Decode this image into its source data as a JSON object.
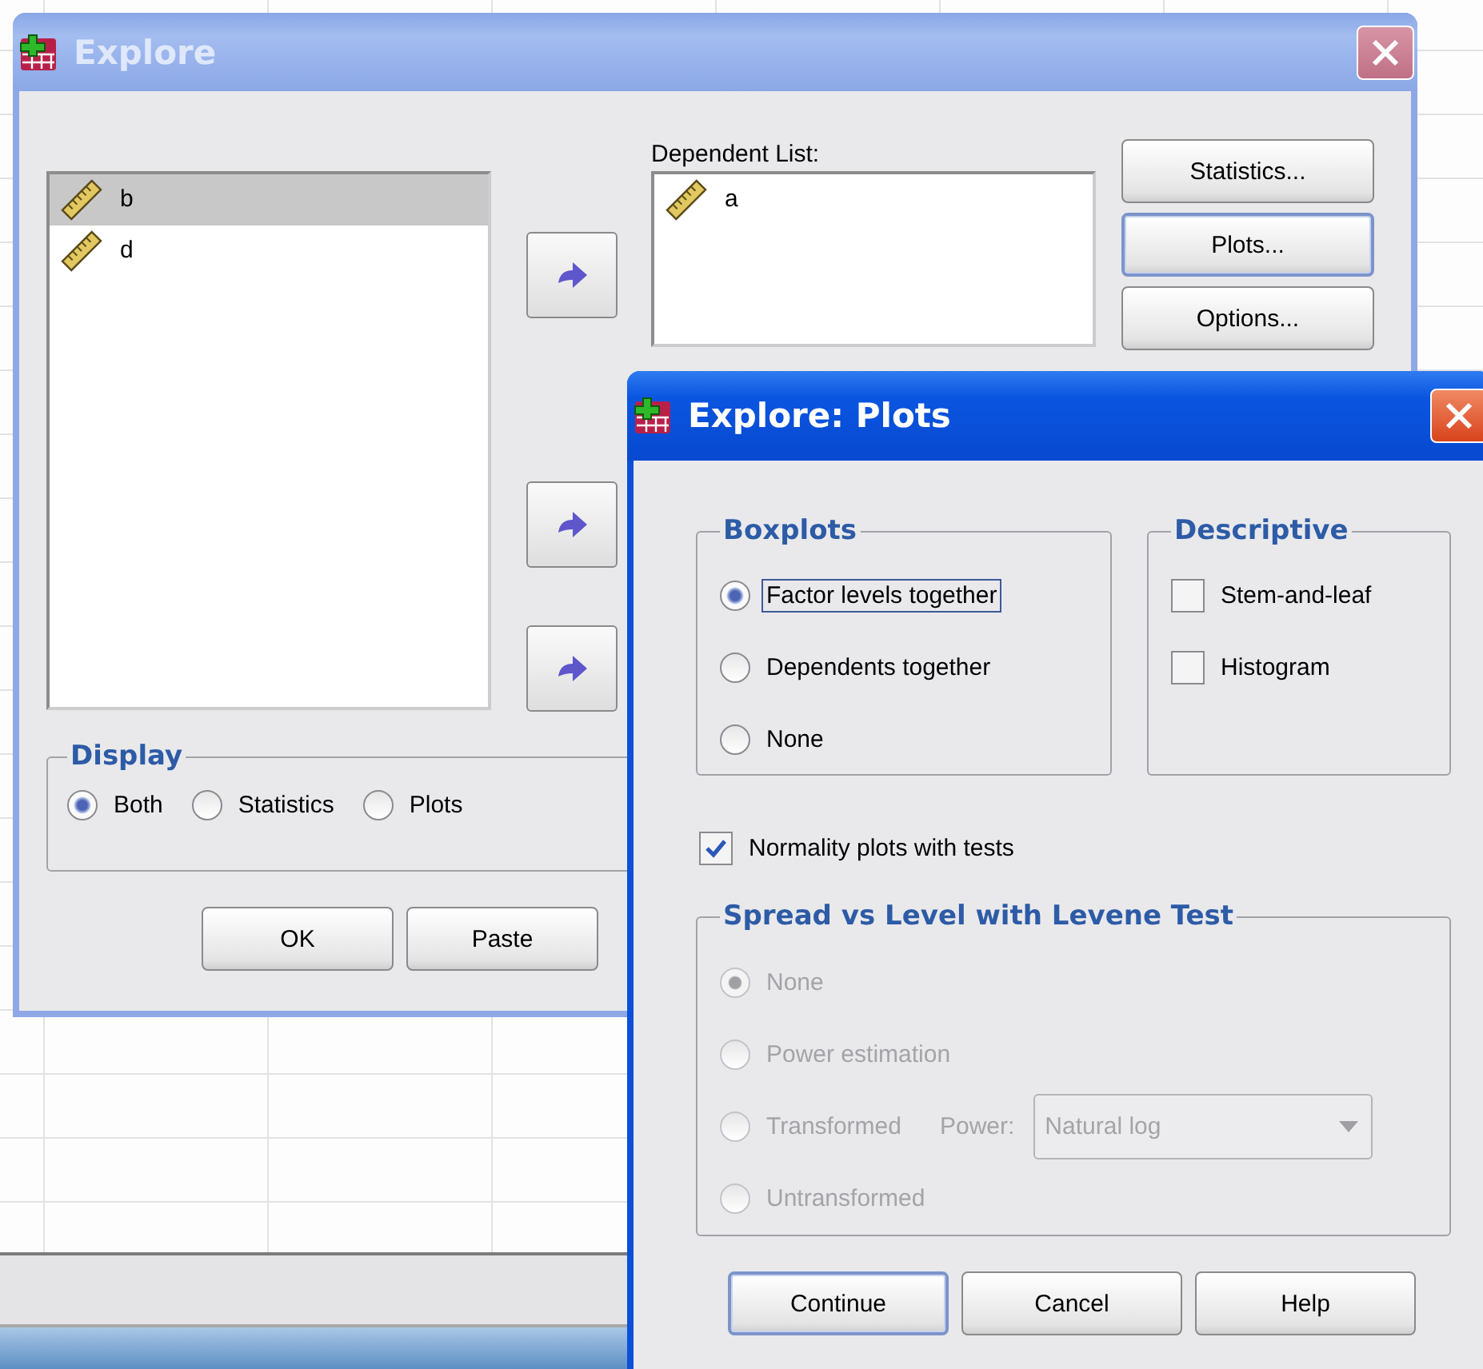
{
  "explore": {
    "title": "Explore",
    "variables": [
      {
        "name": "b",
        "selected": true
      },
      {
        "name": "d",
        "selected": false
      }
    ],
    "dependent_list": {
      "label": "Dependent List:",
      "items": [
        {
          "name": "a"
        }
      ]
    },
    "side_buttons": [
      {
        "label": "Statistics...",
        "focused": false
      },
      {
        "label": "Plots...",
        "focused": true
      },
      {
        "label": "Options...",
        "focused": false
      }
    ],
    "display": {
      "title": "Display",
      "options": [
        {
          "label": "Both",
          "selected": true
        },
        {
          "label": "Statistics",
          "selected": false
        },
        {
          "label": "Plots",
          "selected": false
        }
      ]
    },
    "buttons": [
      {
        "label": "OK"
      },
      {
        "label": "Paste"
      }
    ]
  },
  "plots": {
    "title": "Explore: Plots",
    "boxplots": {
      "title": "Boxplots",
      "options": [
        {
          "label": "Factor levels together",
          "selected": true,
          "focused": true
        },
        {
          "label": "Dependents together",
          "selected": false,
          "focused": false
        },
        {
          "label": "None",
          "selected": false,
          "focused": false
        }
      ]
    },
    "descriptive": {
      "title": "Descriptive",
      "options": [
        {
          "label": "Stem-and-leaf",
          "checked": false
        },
        {
          "label": "Histogram",
          "checked": false
        }
      ]
    },
    "normality": {
      "label": "Normality plots with tests",
      "checked": true
    },
    "spread": {
      "title": "Spread vs Level with Levene Test",
      "disabled": true,
      "options": [
        {
          "kind": "plain",
          "label": "None",
          "selected": true
        },
        {
          "kind": "plain",
          "label": "Power estimation",
          "selected": false
        },
        {
          "kind": "power",
          "label": "Transformed",
          "selected": false,
          "power": {
            "label": "Power:",
            "value": "Natural log"
          }
        },
        {
          "kind": "plain",
          "label": "Untransformed",
          "selected": false
        }
      ]
    },
    "buttons": [
      {
        "label": "Continue",
        "default": true
      },
      {
        "label": "Cancel",
        "default": false
      },
      {
        "label": "Help",
        "default": false
      }
    ]
  }
}
